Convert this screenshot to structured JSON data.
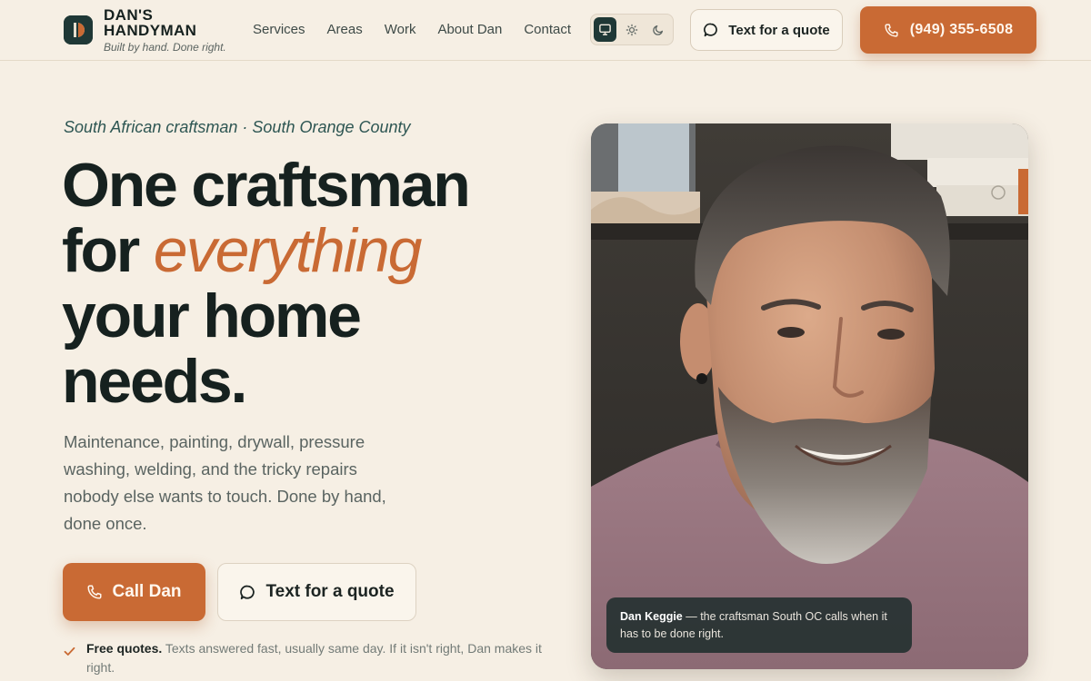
{
  "header": {
    "brand_name": "DAN'S\nHANDYMAN",
    "brand_tagline": "Built by hand. Done right.",
    "nav": [
      "Services",
      "Areas",
      "Work",
      "About Dan",
      "Contact"
    ],
    "theme_modes": [
      "system-icon",
      "sun-icon",
      "moon-icon"
    ],
    "theme_active": "system",
    "text_quote_label": "Text for a quote",
    "phone_label": "(949) 355-6508"
  },
  "hero": {
    "eyebrow": "South African craftsman · South Orange County",
    "headline_1": "One craftsman",
    "headline_2": "for ",
    "headline_accent": "everything",
    "headline_3": "your home",
    "headline_4": "needs.",
    "lead": "Maintenance, painting, drywall, pressure washing, welding, and the tricky repairs nobody else wants to touch. Done by hand, done once.",
    "call_label": "Call Dan",
    "text_label": "Text for a quote",
    "note_strong": "Free quotes.",
    "note_rest": " Texts answered fast, usually same day. If it isn't right, Dan makes it right."
  },
  "photo": {
    "caption_name": "Dan Keggie",
    "caption_rest": " — the craftsman South OC calls when it has to be done right."
  },
  "colors": {
    "background": "#f6efe4",
    "accent": "#c96a34",
    "brand_dark": "#1f3836",
    "text": "#16211f"
  }
}
